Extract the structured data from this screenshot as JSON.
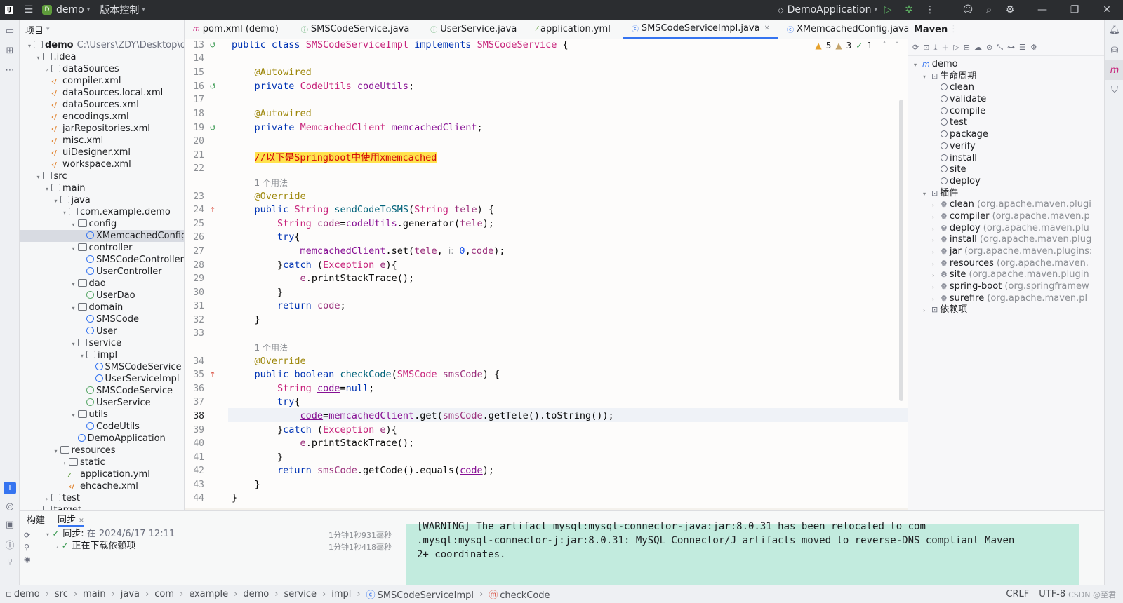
{
  "titlebar": {
    "project": "demo",
    "vcs": "版本控制",
    "run_config": "DemoApplication"
  },
  "project_panel": {
    "title": "项目",
    "items": [
      {
        "label": "demo",
        "extra": "C:\\Users\\ZDY\\Desktop\\de"
      },
      {
        "label": ".idea"
      },
      {
        "label": "dataSources"
      },
      {
        "label": "compiler.xml"
      },
      {
        "label": "dataSources.local.xml"
      },
      {
        "label": "dataSources.xml"
      },
      {
        "label": "encodings.xml"
      },
      {
        "label": "jarRepositories.xml"
      },
      {
        "label": "misc.xml"
      },
      {
        "label": "uiDesigner.xml"
      },
      {
        "label": "workspace.xml"
      },
      {
        "label": "src"
      },
      {
        "label": "main"
      },
      {
        "label": "java"
      },
      {
        "label": "com.example.demo"
      },
      {
        "label": "config"
      },
      {
        "label": "XMemcachedConfig"
      },
      {
        "label": "controller"
      },
      {
        "label": "SMSCodeController"
      },
      {
        "label": "UserController"
      },
      {
        "label": "dao"
      },
      {
        "label": "UserDao"
      },
      {
        "label": "domain"
      },
      {
        "label": "SMSCode"
      },
      {
        "label": "User"
      },
      {
        "label": "service"
      },
      {
        "label": "impl"
      },
      {
        "label": "SMSCodeService"
      },
      {
        "label": "UserServiceImpl"
      },
      {
        "label": "SMSCodeService"
      },
      {
        "label": "UserService"
      },
      {
        "label": "utils"
      },
      {
        "label": "CodeUtils"
      },
      {
        "label": "DemoApplication"
      },
      {
        "label": "resources"
      },
      {
        "label": "static"
      },
      {
        "label": "application.yml"
      },
      {
        "label": "ehcache.xml"
      },
      {
        "label": "test"
      },
      {
        "label": "target"
      }
    ]
  },
  "tabs": [
    {
      "label": "pom.xml (demo)"
    },
    {
      "label": "SMSCodeService.java"
    },
    {
      "label": "UserService.java"
    },
    {
      "label": "application.yml"
    },
    {
      "label": "SMSCodeServiceImpl.java"
    },
    {
      "label": "XMemcachedConfig.java"
    }
  ],
  "inspections": {
    "warnings": "5",
    "weak": "3",
    "ok": "1"
  },
  "editor": {
    "line_numbers": [
      "13",
      "14",
      "15",
      "16",
      "17",
      "18",
      "19",
      "20",
      "21",
      "22",
      "23",
      "24",
      "25",
      "26",
      "27",
      "28",
      "29",
      "30",
      "31",
      "32",
      "33",
      "34",
      "35",
      "36",
      "37",
      "38",
      "39",
      "40",
      "41",
      "42",
      "43",
      "44"
    ],
    "usages_hint": "1 个用法",
    "comment": "//以下是Springboot中使用xmemcached"
  },
  "maven": {
    "title": "Maven",
    "root": "demo",
    "lifecycle_label": "生命周期",
    "lifecycle": [
      "clean",
      "validate",
      "compile",
      "test",
      "package",
      "verify",
      "install",
      "site",
      "deploy"
    ],
    "plugins_label": "插件",
    "plugins": [
      {
        "name": "clean",
        "group": "(org.apache.maven.plugi"
      },
      {
        "name": "compiler",
        "group": "(org.apache.maven.p"
      },
      {
        "name": "deploy",
        "group": "(org.apache.maven.plu"
      },
      {
        "name": "install",
        "group": "(org.apache.maven.plug"
      },
      {
        "name": "jar",
        "group": "(org.apache.maven.plugins:"
      },
      {
        "name": "resources",
        "group": "(org.apache.maven."
      },
      {
        "name": "site",
        "group": "(org.apache.maven.plugin"
      },
      {
        "name": "spring-boot",
        "group": "(org.springframew"
      },
      {
        "name": "surefire",
        "group": "(org.apache.maven.pl"
      }
    ],
    "deps_label": "依赖项"
  },
  "bottom": {
    "tab_build": "构建",
    "tab_sync": "同步",
    "sync_line": "同步:",
    "sync_time": "在 2024/6/17 12:11",
    "sync_dur": "1分钟1秒931毫秒",
    "download_line": "正在下载依赖项",
    "download_dur": "1分钟1秒418毫秒",
    "console_l1": "[WARNING] The artifact mysql:mysql-connector-java:jar:8.0.31 has been relocated to com",
    "console_l2": ".mysql:mysql-connector-j:jar:8.0.31: MySQL Connector/J artifacts moved to reverse-DNS compliant Maven",
    "console_l3": "2+ coordinates."
  },
  "status": {
    "breadcrumbs": [
      "demo",
      "src",
      "main",
      "java",
      "com",
      "example",
      "demo",
      "service",
      "impl",
      "SMSCodeServiceImpl",
      "checkCode"
    ],
    "line_sep": "CRLF",
    "encoding": "UTF-8",
    "watermark": "CSDN @至君"
  }
}
